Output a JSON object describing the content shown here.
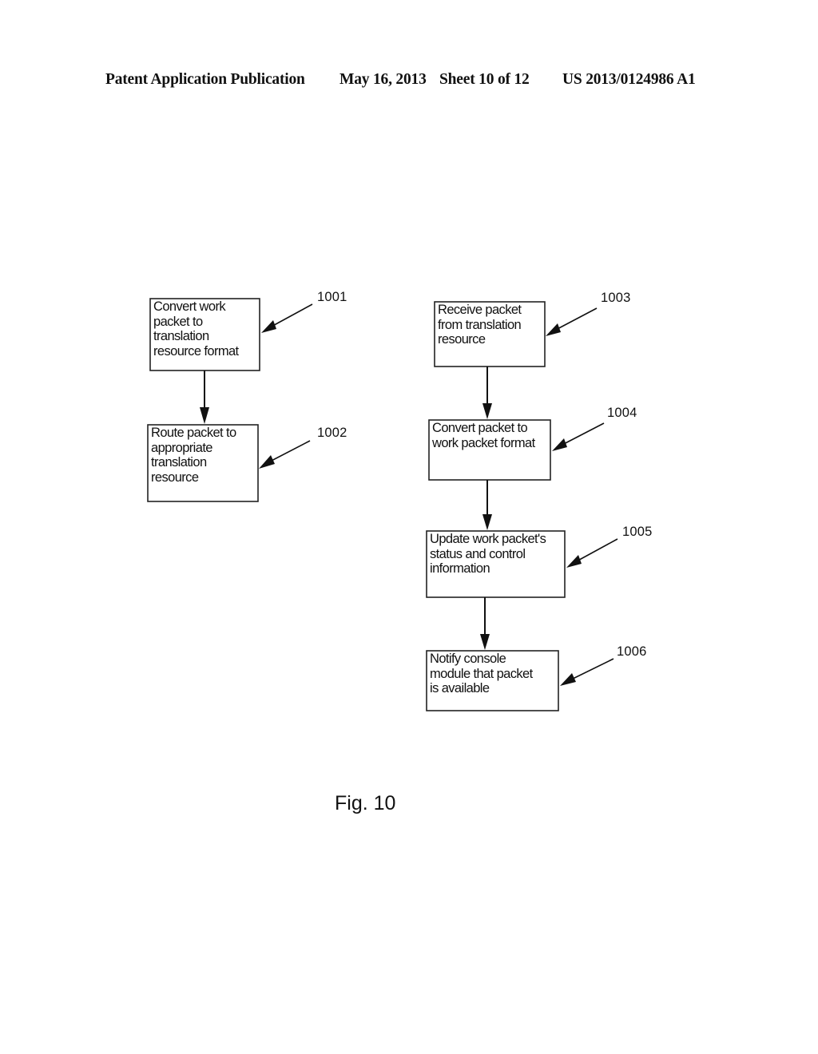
{
  "header": {
    "publication": "Patent Application Publication",
    "date": "May 16, 2013",
    "sheet": "Sheet 10 of 12",
    "number": "US 2013/0124986 A1"
  },
  "diagram": {
    "steps": [
      {
        "id": "1001",
        "text": "Convert work\npacket to\ntranslation\nresource format"
      },
      {
        "id": "1002",
        "text": "Route packet to\nappropriate\ntranslation\nresource"
      },
      {
        "id": "1003",
        "text": "Receive packet\nfrom translation\nresource"
      },
      {
        "id": "1004",
        "text": "Convert packet to\nwork packet format"
      },
      {
        "id": "1005",
        "text": "Update work packet's\nstatus and control\ninformation"
      },
      {
        "id": "1006",
        "text": "Notify console\nmodule that packet\nis available"
      }
    ],
    "flows": [
      {
        "from": "1001",
        "to": "1002"
      },
      {
        "from": "1003",
        "to": "1004"
      },
      {
        "from": "1004",
        "to": "1005"
      },
      {
        "from": "1005",
        "to": "1006"
      }
    ],
    "caption": "Fig. 10"
  }
}
